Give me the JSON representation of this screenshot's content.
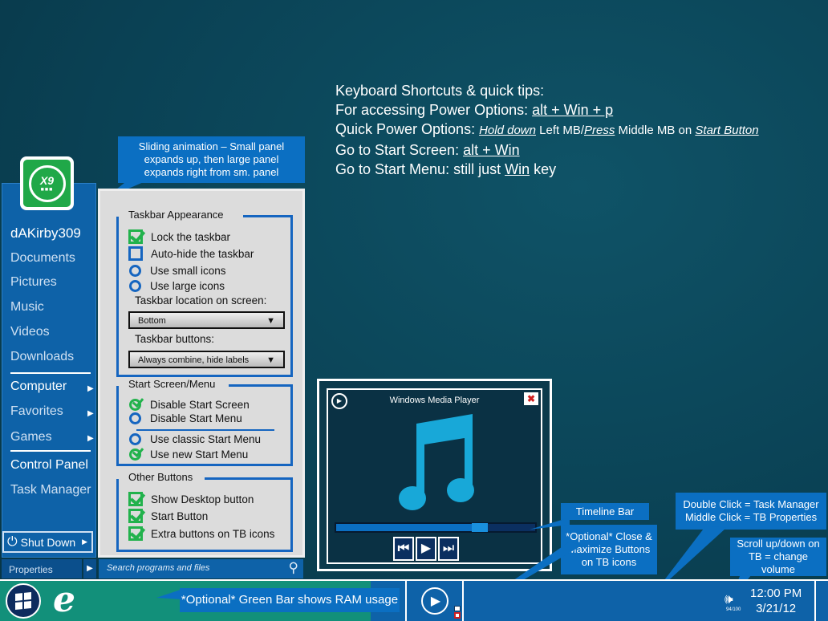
{
  "tips": {
    "heading": "Keyboard Shortcuts & quick tips:",
    "power_label": "For accessing Power Options: ",
    "power_key": "alt + Win + p",
    "quick_label": "Quick Power Options: ",
    "quick_hold": "Hold down",
    "quick_left": " Left MB/",
    "quick_press": "Press",
    "quick_middle": " Middle MB on ",
    "quick_start": "Start Button",
    "screen_label": "Go to Start Screen: ",
    "screen_key": "alt + Win",
    "menu_label": "Go to Start Menu: still just ",
    "menu_key": "Win",
    "menu_suffix": " key"
  },
  "callouts": {
    "sliding": "Sliding animation – Small panel expands up, then large panel expands right from sm. panel",
    "timeline": "Timeline Bar",
    "optional_close": "*Optional* Close & Maximize Buttons on TB icons",
    "double_click": "Double Click = Task Manager Middle Click = TB Properties",
    "scroll": "Scroll up/down on TB = change volume",
    "green_bar": "*Optional* Green Bar shows RAM usage"
  },
  "logo": {
    "text": "X9"
  },
  "left_menu": {
    "user": "dAKirby309",
    "items": [
      "Documents",
      "Pictures",
      "Music",
      "Videos",
      "Downloads"
    ],
    "computer": "Computer",
    "favorites": "Favorites",
    "games": "Games",
    "control_panel": "Control Panel",
    "task_manager": "Task Manager",
    "shut_down": "Shut Down",
    "properties": "Properties"
  },
  "settings": {
    "taskbar_appearance": "Taskbar Appearance",
    "lock": "Lock the taskbar",
    "autohide": "Auto-hide the taskbar",
    "small_icons": "Use small icons",
    "large_icons": "Use large icons",
    "location_label": "Taskbar location on screen:",
    "location_value": "Bottom",
    "buttons_label": "Taskbar buttons:",
    "buttons_value": "Always combine, hide labels",
    "start_group": "Start Screen/Menu",
    "disable_screen": "Disable Start Screen",
    "disable_menu": "Disable Start Menu",
    "classic": "Use classic Start Menu",
    "new_menu": "Use new Start Menu",
    "other_group": "Other Buttons",
    "show_desktop": "Show Desktop button",
    "start_button": "Start Button",
    "extra_buttons": "Extra buttons on TB icons"
  },
  "search": {
    "placeholder": "Search programs and files"
  },
  "wmp": {
    "title": "Windows Media Player",
    "progress": 0.72
  },
  "tray": {
    "volume": "94/100",
    "time": "12:00 PM",
    "date": "3/21/12"
  }
}
